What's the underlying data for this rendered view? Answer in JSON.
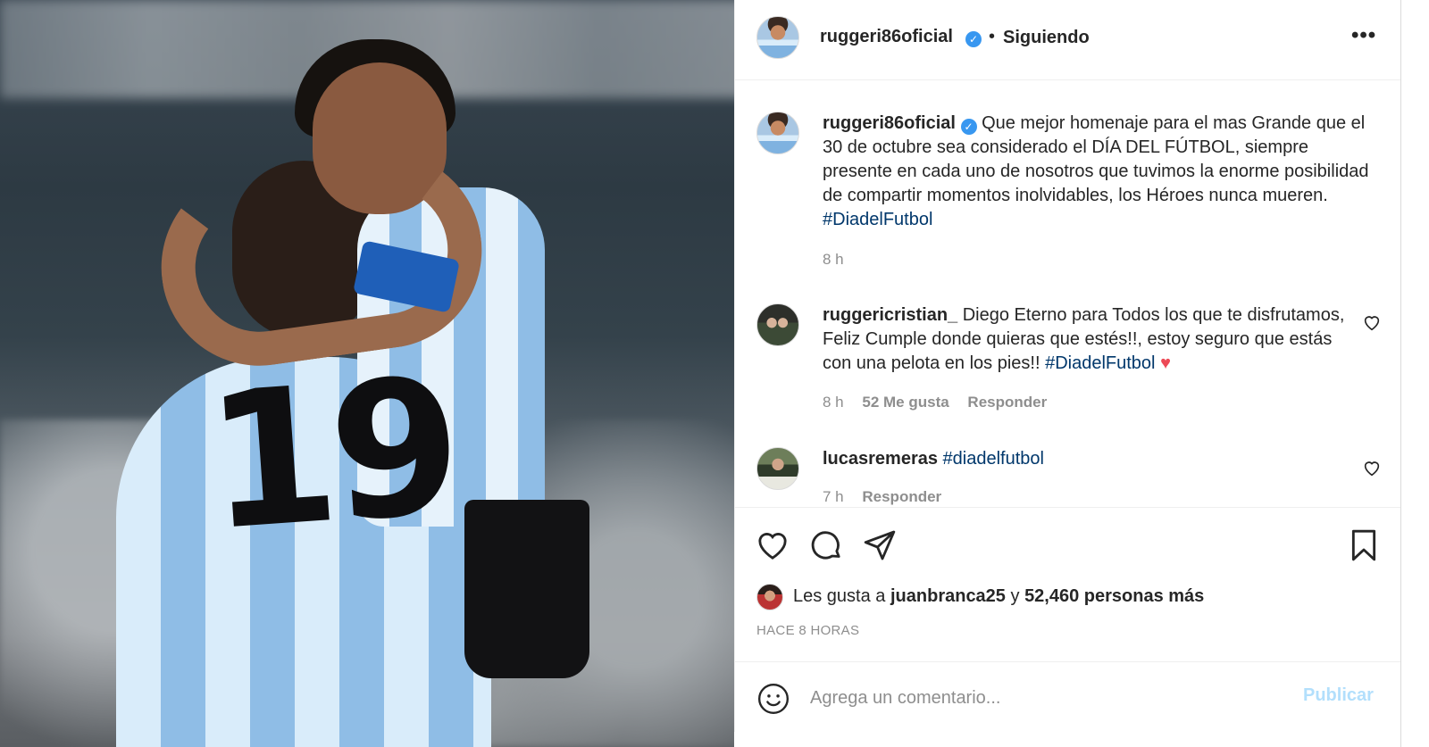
{
  "post": {
    "author": "ruggeri86oficial",
    "verified_mark": "✓",
    "separator": "•",
    "follow_status": "Siguiendo",
    "more_label": "•••",
    "photo_jersey_number": "19"
  },
  "caption": {
    "username": "ruggeri86oficial",
    "text": "Que mejor homenaje para el mas Grande que el 30 de octubre sea considerado el DÍA DEL FÚTBOL, siempre presente en cada uno de nosotros que tuvimos la enorme posibilidad de compartir momentos inolvidables, los Héroes nunca mueren.",
    "hashtag": "#DiadelFutbol",
    "time": "8 h"
  },
  "comments": [
    {
      "username": "ruggericristian_",
      "text": "Diego Eterno para Todos los que te disfrutamos, Feliz Cumple donde quieras que estés!!, estoy seguro que estás con una pelota en los pies!!",
      "hashtag": "#DiadelFutbol",
      "emoji": "♥",
      "time": "8 h",
      "likes": "52 Me gusta",
      "reply": "Responder"
    },
    {
      "username": "lucasremeras",
      "text": "",
      "hashtag": "#diadelfutbol",
      "time": "7 h",
      "reply": "Responder"
    }
  ],
  "likes": {
    "prefix": "Les gusta a",
    "user": "juanbranca25",
    "connector": "y",
    "others": "52,460 personas más"
  },
  "time_ago": "HACE 8 HORAS",
  "composer": {
    "placeholder": "Agrega un comentario...",
    "publish_label": "Publicar"
  },
  "icons": {
    "like": "heart-icon",
    "comment": "comment-icon",
    "share": "share-icon",
    "save": "bookmark-icon",
    "emoji": "smiley-icon",
    "more": "more-icon"
  },
  "colors": {
    "link": "#00376b",
    "verified": "#3897f0",
    "muted": "#8e8e8e",
    "publish_disabled": "#b2dffc",
    "heart": "#ed4956"
  }
}
